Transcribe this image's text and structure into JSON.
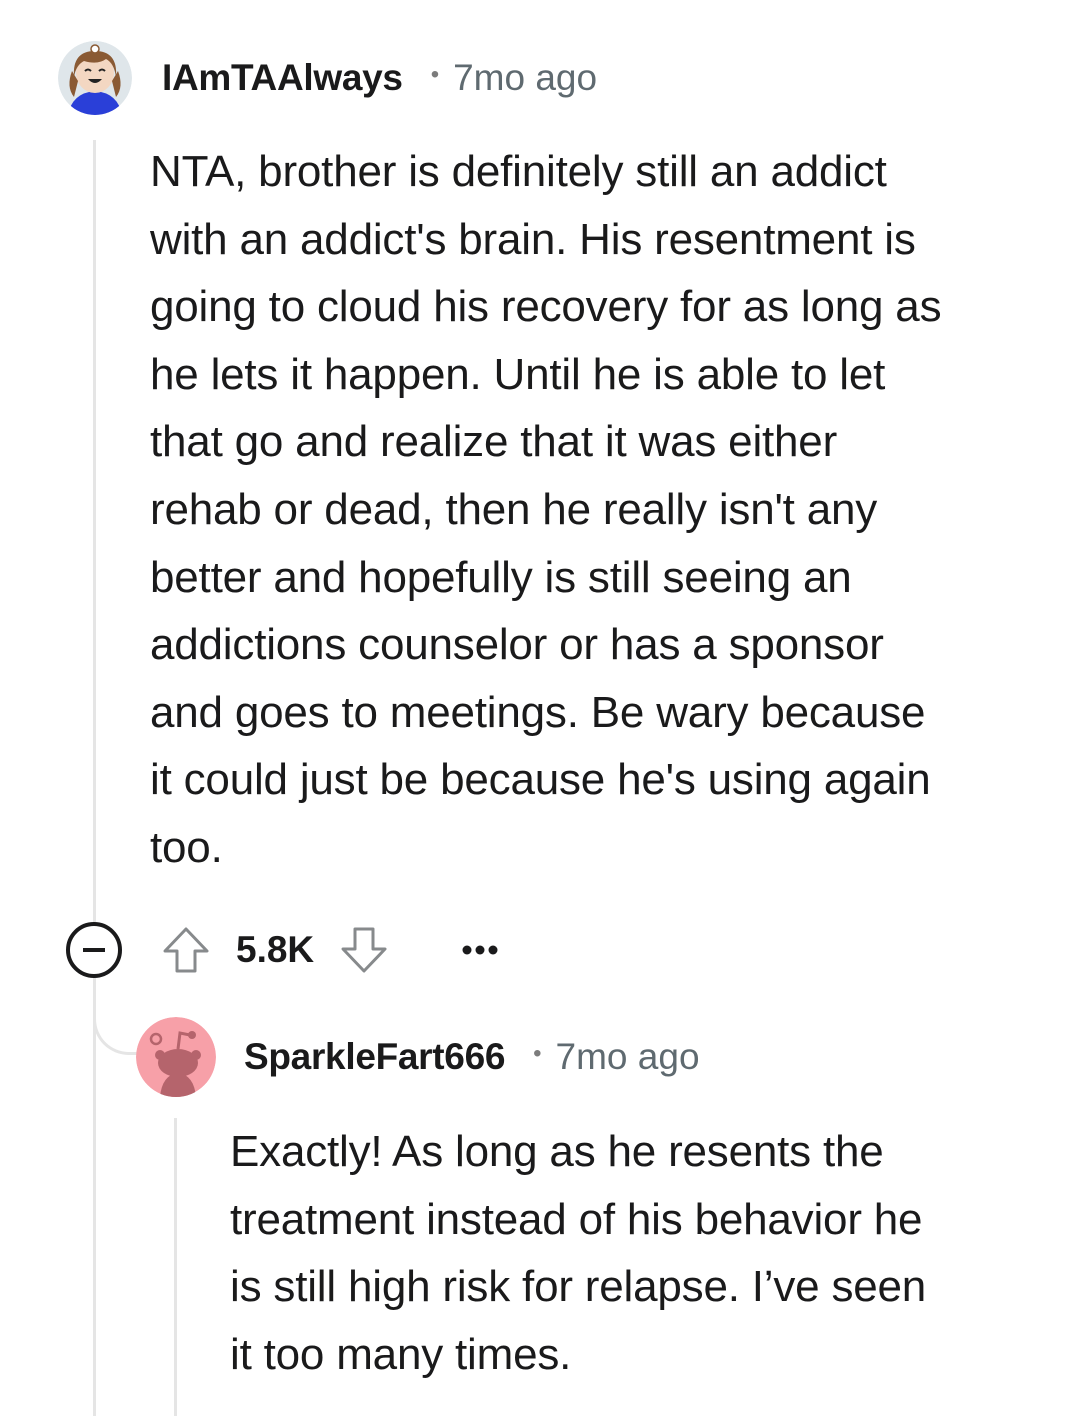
{
  "comments": [
    {
      "username": "IAmTAAlways",
      "separator": "•",
      "timestamp": "7mo ago",
      "avatar_icon": "user-avatar-icon",
      "body_lines": [
        "NTA, brother is definitely still an addict",
        "with an addict's brain. His resentment is",
        "going to cloud his recovery for as long as",
        "he lets it happen. Until he is able to let",
        "that go and realize that it was either",
        "rehab or dead, then he really isn't any",
        "better and hopefully is still seeing an",
        "addictions counselor or has a sponsor",
        "and goes to meetings. Be wary because",
        "it could just be because he's using again",
        "too."
      ],
      "score": "5.8K"
    },
    {
      "username": "SparkleFart666",
      "separator": "•",
      "timestamp": "7mo ago",
      "avatar_icon": "snoo-avatar-icon",
      "body_lines": [
        "Exactly! As long as he resents the",
        "treatment instead of his behavior he",
        "is still high risk for relapse. I’ve seen",
        "it too many times."
      ]
    }
  ],
  "actions": {
    "collapse_icon": "minus-icon",
    "upvote_icon": "arrow-up-icon",
    "downvote_icon": "arrow-down-icon",
    "more_icon": "ellipsis-icon"
  },
  "colors": {
    "text": "#1a1a1b",
    "meta": "#5f6a70",
    "thread_line": "#e5e5e5",
    "snoo_bg": "#f7a0a8"
  }
}
